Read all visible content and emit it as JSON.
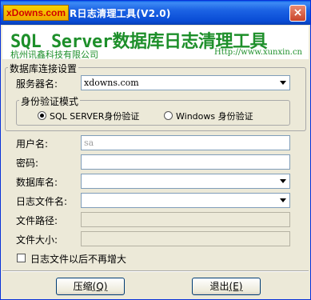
{
  "window": {
    "logo_text": "xDowns.com",
    "title": "R日志清理工具(V2.0)",
    "close_glyph": "×"
  },
  "banner": {
    "title": "SQL Server数据库日志清理工具",
    "company": "杭州讯鑫科技有限公司",
    "url": "Http://www.xunxin.cn"
  },
  "connection_group": {
    "label": "数据库连接设置",
    "server_label": "服务器名:",
    "server_value": "xdowns.com",
    "auth_group": {
      "label": "身份验证模式",
      "options": [
        {
          "label": "SQL SERVER身份验证",
          "selected": true
        },
        {
          "label": "Windows 身份验证",
          "selected": false
        }
      ]
    }
  },
  "form": {
    "username_label": "用户名:",
    "username_value": "sa",
    "password_label": "密码:",
    "password_value": "",
    "database_label": "数据库名:",
    "database_value": "",
    "logfile_label": "日志文件名:",
    "logfile_value": "",
    "filepath_label": "文件路径:",
    "filepath_value": "",
    "filesize_label": "文件大小:",
    "filesize_value": "",
    "no_grow_checkbox": {
      "label": "日志文件以后不再增大",
      "checked": false
    }
  },
  "buttons": {
    "compress_label": "压缩",
    "compress_hotkey": "(Q)",
    "exit_label": "退出",
    "exit_hotkey": "(E)"
  }
}
